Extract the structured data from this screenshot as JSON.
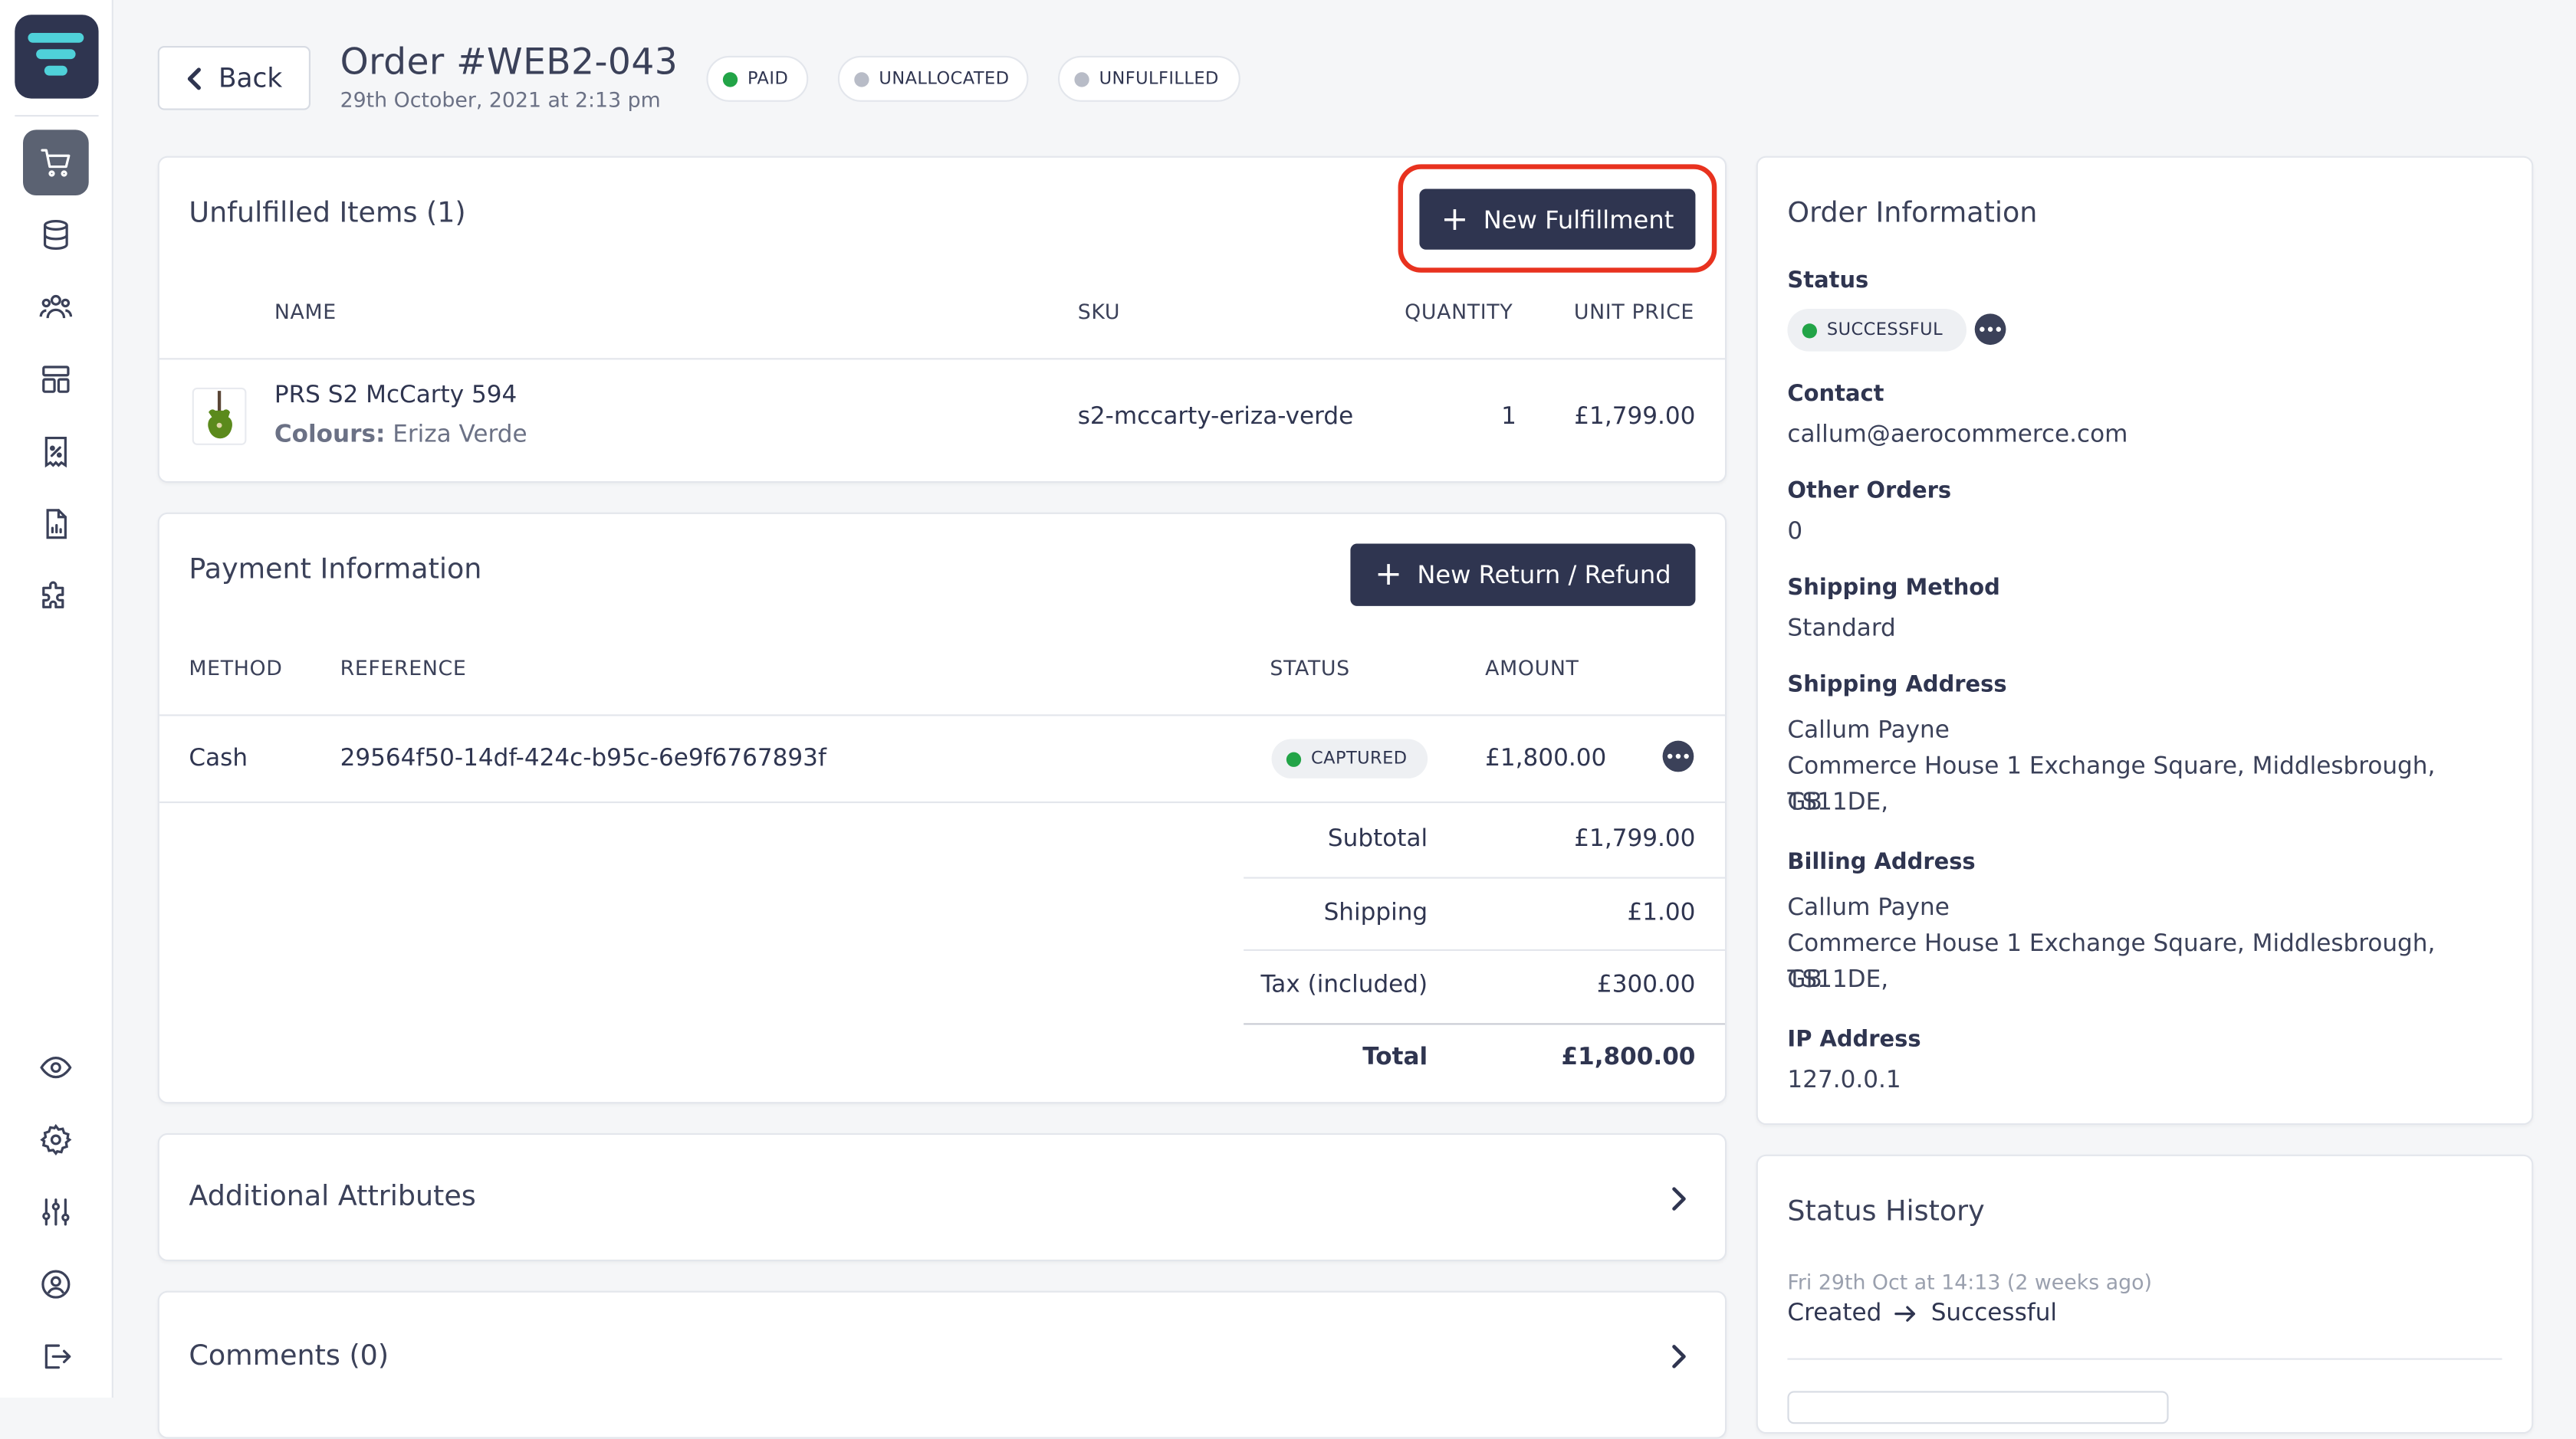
{
  "header": {
    "back_label": "Back",
    "order_title": "Order #WEB2-043",
    "order_date": "29th October, 2021 at 2:13 pm",
    "badges": [
      {
        "label": "PAID",
        "color": "#22a447"
      },
      {
        "label": "UNALLOCATED",
        "color": "#b8bcc7"
      },
      {
        "label": "UNFULFILLED",
        "color": "#b8bcc7"
      }
    ]
  },
  "sidebar": {
    "items": [
      {
        "icon": "cart-icon",
        "label": "Orders"
      },
      {
        "icon": "database-icon",
        "label": "Catalog"
      },
      {
        "icon": "users-icon",
        "label": "Customers"
      },
      {
        "icon": "layout-icon",
        "label": "Content"
      },
      {
        "icon": "discount-icon",
        "label": "Promotions"
      },
      {
        "icon": "report-icon",
        "label": "Reports"
      },
      {
        "icon": "puzzle-icon",
        "label": "Modules"
      },
      {
        "icon": "eye-icon",
        "label": "Preview"
      },
      {
        "icon": "gear-icon",
        "label": "Settings"
      },
      {
        "icon": "sliders-icon",
        "label": "Configuration"
      },
      {
        "icon": "user-circle-icon",
        "label": "Account"
      },
      {
        "icon": "logout-icon",
        "label": "Logout"
      }
    ]
  },
  "unfulfilled": {
    "title": "Unfulfilled Items (1)",
    "new_fulfillment_label": "New Fulfillment",
    "columns": {
      "name": "NAME",
      "sku": "SKU",
      "quantity": "QUANTITY",
      "unit_price": "UNIT PRICE"
    },
    "items": [
      {
        "name": "PRS S2 McCarty 594",
        "option_label": "Colours:",
        "option_value": "Eriza Verde",
        "sku": "s2-mccarty-eriza-verde",
        "quantity": "1",
        "unit_price": "£1,799.00"
      }
    ]
  },
  "payment": {
    "title": "Payment Information",
    "new_return_label": "New Return / Refund",
    "columns": {
      "method": "METHOD",
      "reference": "REFERENCE",
      "status": "STATUS",
      "amount": "AMOUNT"
    },
    "rows": [
      {
        "method": "Cash",
        "reference": "29564f50-14df-424c-b95c-6e9f6767893f",
        "status": "CAPTURED",
        "status_color": "#22a447",
        "amount": "£1,800.00"
      }
    ],
    "totals": [
      {
        "label": "Subtotal",
        "value": "£1,799.00"
      },
      {
        "label": "Shipping",
        "value": "£1.00"
      },
      {
        "label": "Tax (included)",
        "value": "£300.00"
      }
    ],
    "total": {
      "label": "Total",
      "value": "£1,800.00"
    }
  },
  "additional_attributes": {
    "title": "Additional Attributes"
  },
  "comments": {
    "title": "Comments (0)"
  },
  "order_info": {
    "title": "Order Information",
    "status_label": "Status",
    "status_value": "SUCCESSFUL",
    "status_color": "#22a447",
    "contact_label": "Contact",
    "contact_value": "callum@aerocommerce.com",
    "other_orders_label": "Other Orders",
    "other_orders_value": "0",
    "shipping_method_label": "Shipping Method",
    "shipping_method_value": "Standard",
    "shipping_address_label": "Shipping Address",
    "shipping_address_name": "Callum Payne",
    "shipping_address_line": "Commerce House 1 Exchange Square, Middlesbrough, TS11DE,",
    "shipping_address_country": "GB",
    "billing_address_label": "Billing Address",
    "billing_address_name": "Callum Payne",
    "billing_address_line": "Commerce House 1 Exchange Square, Middlesbrough, TS11DE,",
    "billing_address_country": "GB",
    "ip_label": "IP Address",
    "ip_value": "127.0.0.1"
  },
  "status_history": {
    "title": "Status History",
    "entries": [
      {
        "time": "Fri 29th Oct at 14:13 (2 weeks ago)",
        "from": "Created",
        "to": "Successful"
      }
    ]
  },
  "colors": {
    "primary": "#2f3550",
    "highlight": "#e8321f",
    "success": "#22a447",
    "neutral": "#b8bcc7"
  }
}
